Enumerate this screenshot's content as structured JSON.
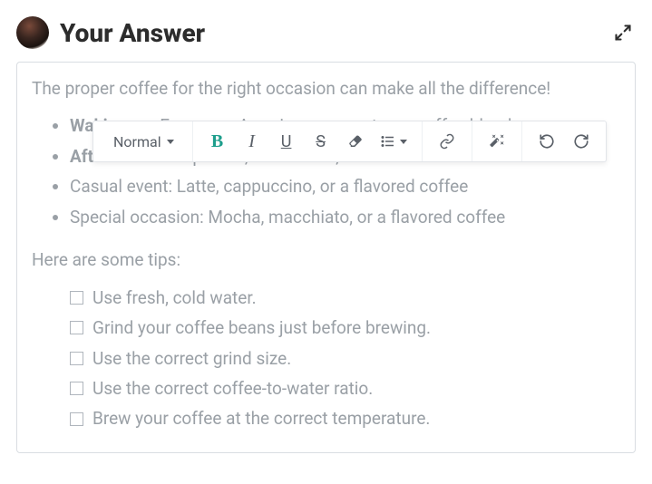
{
  "header": {
    "title": "Your Answer"
  },
  "toolbar": {
    "format_label": "Normal"
  },
  "editor": {
    "intro": "The proper coffee for the right occasion can make all the difference!",
    "bullets": [
      {
        "label": "Waking up:",
        "text": " Espresso, Americano, or a strong coffee blend",
        "bold": true
      },
      {
        "label": "After a meal:",
        "text": " Espresso, Americano, or a dark roast coffee",
        "bold": true
      },
      {
        "label": "Casual event:",
        "text": " Latte, cappuccino, or a flavored coffee",
        "bold": false
      },
      {
        "label": "Special occasion:",
        "text": " Mocha, macchiato, or a flavored coffee",
        "bold": false
      }
    ],
    "tips_heading": "Here are some tips:",
    "tips": [
      "Use fresh, cold water.",
      "Grind your coffee beans just before brewing.",
      "Use the correct grind size.",
      "Use the correct coffee-to-water ratio.",
      "Brew your coffee at the correct temperature."
    ]
  }
}
